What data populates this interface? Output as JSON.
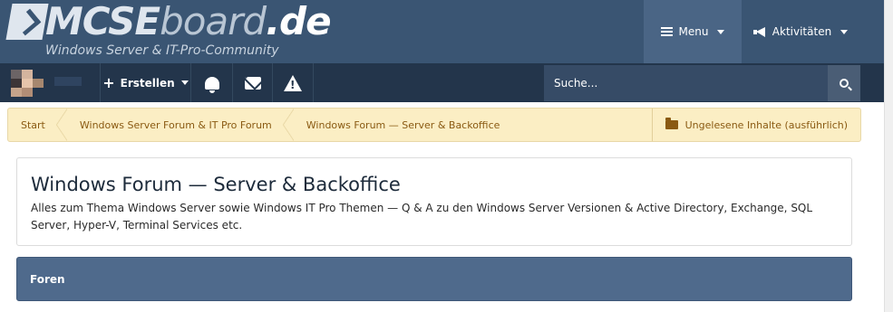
{
  "header": {
    "logo": {
      "main": "MCSE",
      "board": "board",
      "tld": ".de",
      "tagline": "Windows Server & IT-Pro-Community"
    },
    "nav": [
      {
        "label": "Menu",
        "icon": "hamburger-icon"
      },
      {
        "label": "Aktivitäten",
        "icon": "megaphone-icon"
      }
    ]
  },
  "toolbar": {
    "create_label": "Erstellen",
    "icons": [
      "bell-icon",
      "envelope-icon",
      "warning-icon"
    ],
    "search_placeholder": "Suche..."
  },
  "breadcrumb": {
    "items": [
      "Start",
      "Windows Server Forum & IT Pro Forum",
      "Windows Forum — Server & Backoffice"
    ],
    "unread_label": "Ungelesene Inhalte (ausführlich)"
  },
  "page": {
    "title": "Windows Forum — Server & Backoffice",
    "description": "Alles zum Thema Windows Server sowie Windows IT Pro Themen — Q & A zu den Windows Server Versionen & Active Directory, Exchange, SQL Server, Hyper-V, Terminal Services etc."
  },
  "forums_header": "Foren",
  "colors": {
    "header": "#3a5573",
    "toolbar": "#23354b",
    "breadcrumb": "#fbeec4",
    "accent": "#4f6a8c"
  }
}
